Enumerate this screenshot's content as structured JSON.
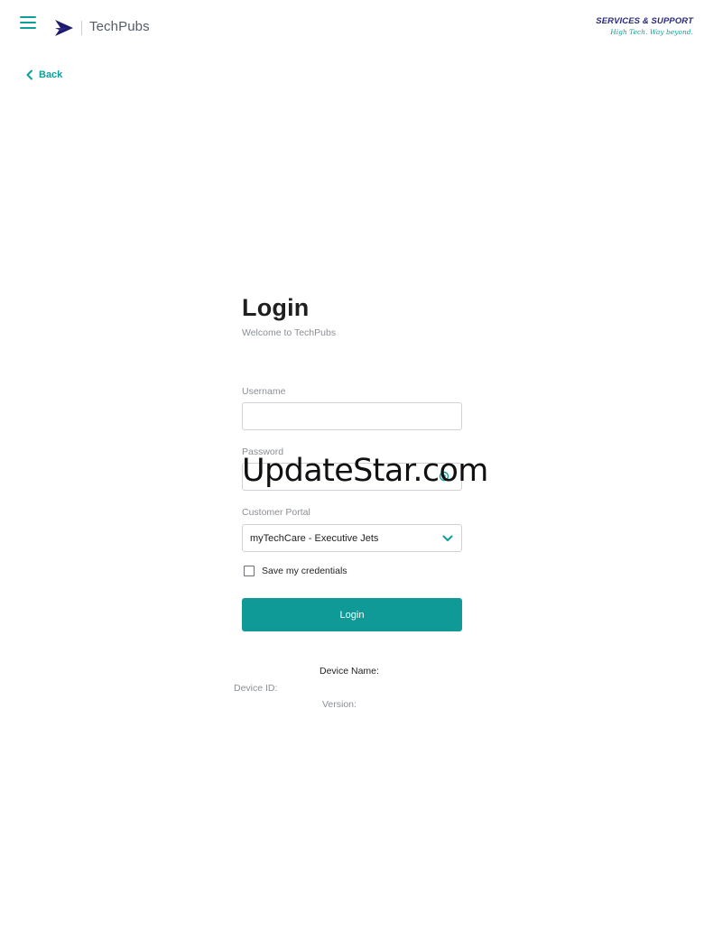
{
  "header": {
    "app_name": "TechPubs",
    "menu_icon": "hamburger-menu-icon",
    "brand_icon": "embraer-arrow-logo",
    "brand_right": {
      "title": "SERVICES & SUPPORT",
      "tagline": "High Tech. Way beyond."
    },
    "accent_color": "#0f9f9b",
    "brand_color": "#2b2a7a"
  },
  "nav": {
    "back_label": "Back",
    "back_icon": "chevron-left-icon"
  },
  "login": {
    "title": "Login",
    "subtitle": "Welcome to TechPubs",
    "username_label": "Username",
    "username_value": "",
    "password_label": "Password",
    "password_value": "",
    "password_icon": "eye-icon",
    "portal_label": "Customer Portal",
    "portal_value": "myTechCare - Executive Jets",
    "portal_icon": "chevron-down-icon",
    "save_credentials_label": "Save my credentials",
    "save_credentials_checked": false,
    "submit_label": "Login",
    "button_color": "#0f9a98"
  },
  "device_info": {
    "device_name_label": "Device Name:",
    "device_id_label": "Device ID:",
    "version_label": "Version:"
  },
  "overlay": {
    "watermark": "UpdateStar.com"
  }
}
